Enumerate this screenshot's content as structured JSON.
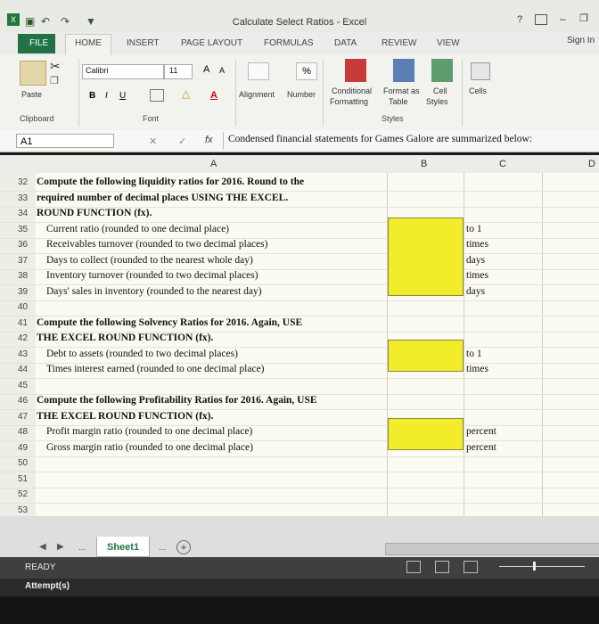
{
  "window": {
    "title": "Calculate Select Ratios - Excel",
    "help_icon": "?",
    "sign_in": "Sign In"
  },
  "tabs": [
    "FILE",
    "HOME",
    "INSERT",
    "PAGE LAYOUT",
    "FORMULAS",
    "DATA",
    "REVIEW",
    "VIEW"
  ],
  "ribbon": {
    "paste": "Paste",
    "font_name": "Calibri",
    "font_size": "11",
    "font_grow": "A",
    "font_shrink": "A",
    "bold": "B",
    "italic": "I",
    "underline": "U",
    "alignment": "Alignment",
    "number": "Number",
    "percent": "%",
    "conditional": "Conditional",
    "formatting": "Formatting",
    "format_as": "Format as",
    "table": "Table",
    "cell": "Cell",
    "styles": "Styles",
    "cells": "Cells",
    "groups": {
      "clipboard": "Clipboard",
      "font": "Font",
      "styles": "Styles"
    }
  },
  "formula_bar": {
    "name_box": "A1",
    "fx": "fx",
    "content": "Condensed financial statements for Games Galore are summarized below:"
  },
  "columns": [
    "A",
    "B",
    "C",
    "D"
  ],
  "rows": [
    {
      "n": "32",
      "text": "Compute the following liquidity ratios for 2016. Round to the",
      "bold": true,
      "indent": false
    },
    {
      "n": "33",
      "text": "required number of decimal places USING THE EXCEL.",
      "bold": true,
      "indent": false
    },
    {
      "n": "34",
      "text": "ROUND FUNCTION (fx).",
      "bold": true,
      "indent": false
    },
    {
      "n": "35",
      "text": "Current ratio (rounded to one decimal place)",
      "bold": false,
      "indent": true,
      "unit": "to 1"
    },
    {
      "n": "36",
      "text": "Receivables turnover (rounded to two decimal places)",
      "bold": false,
      "indent": true,
      "unit": "times"
    },
    {
      "n": "37",
      "text": "Days to collect (rounded to the nearest whole day)",
      "bold": false,
      "indent": true,
      "unit": "days"
    },
    {
      "n": "38",
      "text": "Inventory turnover (rounded to two decimal places)",
      "bold": false,
      "indent": true,
      "unit": "times"
    },
    {
      "n": "39",
      "text": "Days' sales in inventory (rounded to the nearest day)",
      "bold": false,
      "indent": true,
      "unit": "days"
    },
    {
      "n": "40",
      "text": "",
      "bold": false,
      "indent": false
    },
    {
      "n": "41",
      "text": "Compute the following Solvency Ratios for 2016. Again, USE",
      "bold": true,
      "indent": false
    },
    {
      "n": "42",
      "text": "THE EXCEL ROUND FUNCTION (fx).",
      "bold": true,
      "indent": false
    },
    {
      "n": "43",
      "text": "Debt to assets (rounded to two decimal places)",
      "bold": false,
      "indent": true,
      "unit": "to 1"
    },
    {
      "n": "44",
      "text": "Times interest earned (rounded to one decimal place)",
      "bold": false,
      "indent": true,
      "unit": "times"
    },
    {
      "n": "45",
      "text": "",
      "bold": false,
      "indent": false
    },
    {
      "n": "46",
      "text": "Compute the following Profitability Ratios for 2016. Again, USE",
      "bold": true,
      "indent": false
    },
    {
      "n": "47",
      "text": "THE EXCEL ROUND FUNCTION (fx).",
      "bold": true,
      "indent": false
    },
    {
      "n": "48",
      "text": "Profit margin ratio (rounded to one decimal place)",
      "bold": false,
      "indent": true,
      "unit": "percent"
    },
    {
      "n": "49",
      "text": "Gross margin ratio (rounded to one decimal place)",
      "bold": false,
      "indent": true,
      "unit": "percent"
    },
    {
      "n": "50",
      "text": "",
      "bold": false,
      "indent": false
    },
    {
      "n": "51",
      "text": "",
      "bold": false,
      "indent": false
    },
    {
      "n": "52",
      "text": "",
      "bold": false,
      "indent": false
    },
    {
      "n": "53",
      "text": "",
      "bold": false,
      "indent": false
    }
  ],
  "sheet_tabs": {
    "ellipsis": "...",
    "active": "Sheet1",
    "more": "...",
    "add": "+"
  },
  "status": {
    "ready": "READY",
    "attempts": "Attempt(s)"
  },
  "colors": {
    "answer_cell": "#f3ec2a",
    "sheet_bg": "#fbfbf2"
  }
}
